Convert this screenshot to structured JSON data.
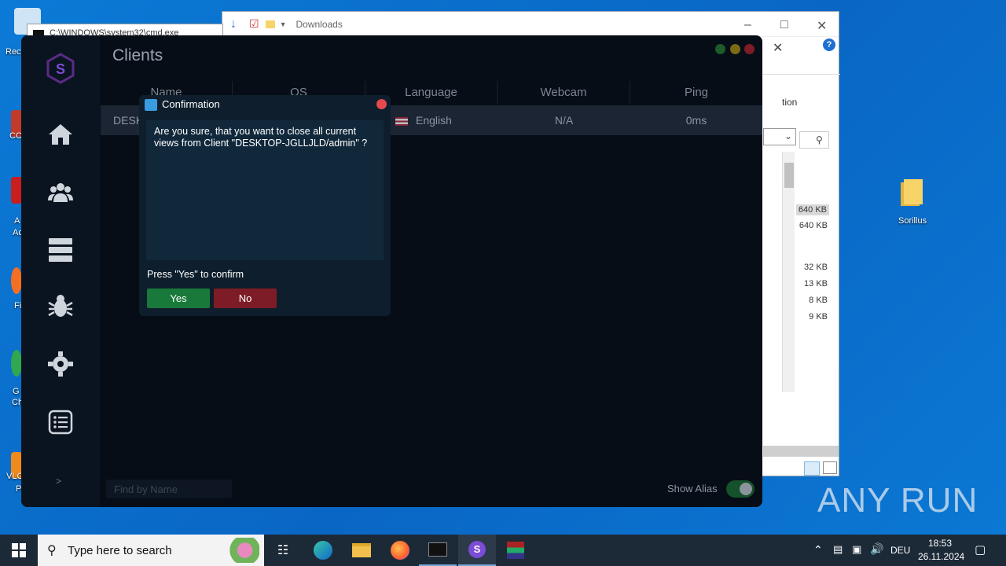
{
  "desktop": {
    "recycle_label": "Recy",
    "icon_labels": [
      "CC",
      "A",
      "Ac",
      "Fi",
      "G",
      "Ch",
      "VLC",
      "P"
    ],
    "folder_label": "Sorillus"
  },
  "cmd": {
    "title": "C:\\WINDOWS\\system32\\cmd.exe"
  },
  "explorer": {
    "title": "Downloads",
    "partial_text": "tion",
    "sizes": [
      "640 KB",
      "640 KB",
      "32 KB",
      "13 KB",
      "8 KB",
      "9 KB"
    ]
  },
  "app": {
    "title": "Clients",
    "columns": [
      "Name",
      "OS",
      "Language",
      "Webcam",
      "Ping"
    ],
    "row": {
      "name": "DESK",
      "language": "English",
      "webcam": "N/A",
      "ping": "0ms"
    },
    "search_placeholder": "Find by Name",
    "show_alias_label": "Show Alias",
    "collapse": ">"
  },
  "dialog": {
    "title": "Confirmation",
    "message": "Are you sure, that you want to close all current views from Client \"DESKTOP-JGLLJLD/admin\" ?",
    "hint": "Press \"Yes\" to confirm",
    "yes": "Yes",
    "no": "No"
  },
  "taskbar": {
    "search_placeholder": "Type here to search",
    "language": "DEU",
    "time": "18:53",
    "date": "26.11.2024"
  },
  "watermark": "ANY RUN",
  "colors": {
    "yes_button": "#19793a",
    "no_button": "#7d1c26",
    "accent": "#7b4cd6"
  }
}
